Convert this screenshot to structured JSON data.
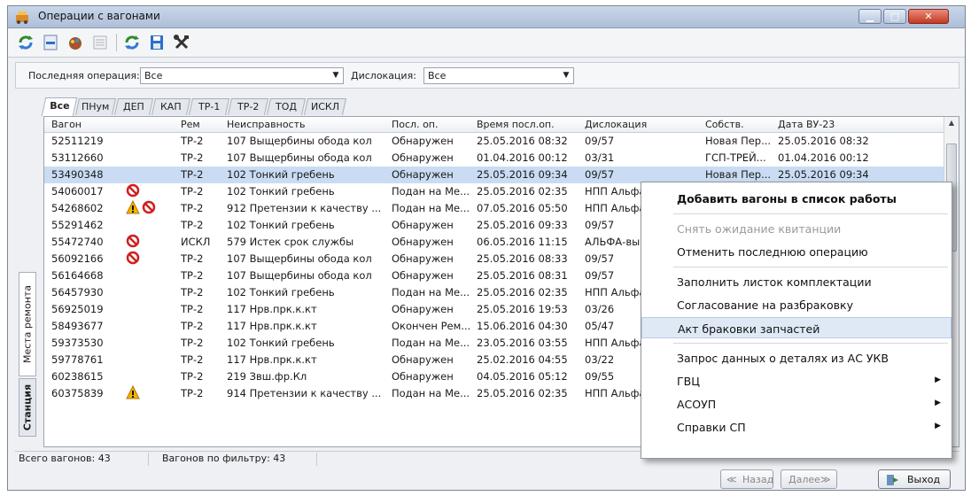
{
  "window": {
    "title": "Операции с вагонами"
  },
  "toolbar": {
    "icons": [
      "refresh-icon",
      "remove-icon",
      "paint-icon",
      "list-icon",
      "reload-icon",
      "save-icon",
      "tools-icon"
    ]
  },
  "filters": {
    "last_operation_label": "Последняя операция:",
    "last_operation_value": "Все",
    "dislocation_label": "Дислокация:",
    "dislocation_value": "Все"
  },
  "tabs": [
    "Все",
    "ПНум",
    "ДЕП",
    "КАП",
    "ТР-1",
    "ТР-2",
    "ТОД",
    "ИСКЛ"
  ],
  "side_tabs": [
    "Места ремонта",
    "Станция"
  ],
  "columns": [
    "Вагон",
    "Рем",
    "Неисправность",
    "Посл. оп.",
    "Время посл.оп.",
    "Дислокация",
    "Собств.",
    "Дата ВУ-23"
  ],
  "rows": [
    {
      "wagon": "52511219",
      "icons": [],
      "rem": "ТР-2",
      "fault": "107 Выщербины обода кол",
      "oper": "Обнаружен",
      "time": "25.05.2016 08:32",
      "disl": "09/57",
      "owner": "Новая Пер...",
      "date": "25.05.2016 08:32"
    },
    {
      "wagon": "53112660",
      "icons": [],
      "rem": "ТР-2",
      "fault": "107 Выщербины обода кол",
      "oper": "Обнаружен",
      "time": "01.04.2016 00:12",
      "disl": "03/31",
      "owner": "ГСП-ТРЕЙ...",
      "date": "01.04.2016 00:12"
    },
    {
      "wagon": "53490348",
      "icons": [],
      "rem": "ТР-2",
      "fault": "102 Тонкий гребень",
      "oper": "Обнаружен",
      "time": "25.05.2016 09:34",
      "disl": "09/57",
      "owner": "Новая Пер...",
      "date": "25.05.2016 09:34"
    },
    {
      "wagon": "54060017",
      "icons": [
        "no-entry-icon"
      ],
      "rem": "ТР-2",
      "fault": "102 Тонкий гребень",
      "oper": "Подан на Ме...",
      "time": "25.05.2016 02:35",
      "disl": "НПП Альфа",
      "owner": "",
      "date": ""
    },
    {
      "wagon": "54268602",
      "icons": [
        "warning-icon",
        "no-entry-icon"
      ],
      "rem": "ТР-2",
      "fault": "912 Претензии к качеству ...",
      "oper": "Подан на Ме...",
      "time": "07.05.2016 05:50",
      "disl": "НПП Альфа",
      "owner": "",
      "date": ""
    },
    {
      "wagon": "55291462",
      "icons": [],
      "rem": "ТР-2",
      "fault": "102 Тонкий гребень",
      "oper": "Обнаружен",
      "time": "25.05.2016 09:33",
      "disl": "09/57",
      "owner": "",
      "date": ""
    },
    {
      "wagon": "55472740",
      "icons": [
        "no-entry-icon"
      ],
      "rem": "ИСКЛ",
      "fault": "579 Истек срок службы",
      "oper": "Обнаружен",
      "time": "06.05.2016 11:15",
      "disl": "АЛЬФА-выгр",
      "owner": "",
      "date": ""
    },
    {
      "wagon": "56092166",
      "icons": [
        "no-entry-icon"
      ],
      "rem": "ТР-2",
      "fault": "107 Выщербины обода кол",
      "oper": "Обнаружен",
      "time": "25.05.2016 08:33",
      "disl": "09/57",
      "owner": "",
      "date": ""
    },
    {
      "wagon": "56164668",
      "icons": [],
      "rem": "ТР-2",
      "fault": "107 Выщербины обода кол",
      "oper": "Обнаружен",
      "time": "25.05.2016 08:31",
      "disl": "09/57",
      "owner": "",
      "date": ""
    },
    {
      "wagon": "56457930",
      "icons": [],
      "rem": "ТР-2",
      "fault": "102 Тонкий гребень",
      "oper": "Подан на Ме...",
      "time": "25.05.2016 02:35",
      "disl": "НПП Альфа",
      "owner": "",
      "date": ""
    },
    {
      "wagon": "56925019",
      "icons": [],
      "rem": "ТР-2",
      "fault": "117 Нрв.прк.к.кт",
      "oper": "Обнаружен",
      "time": "25.05.2016 19:53",
      "disl": "03/26",
      "owner": "",
      "date": ""
    },
    {
      "wagon": "58493677",
      "icons": [],
      "rem": "ТР-2",
      "fault": "117 Нрв.прк.к.кт",
      "oper": "Окончен Рем...",
      "time": "15.06.2016 04:30",
      "disl": "05/47",
      "owner": "",
      "date": ""
    },
    {
      "wagon": "59373530",
      "icons": [],
      "rem": "ТР-2",
      "fault": "102 Тонкий гребень",
      "oper": "Подан на Ме...",
      "time": "23.05.2016 03:55",
      "disl": "НПП Альфа",
      "owner": "",
      "date": ""
    },
    {
      "wagon": "59778761",
      "icons": [],
      "rem": "ТР-2",
      "fault": "117 Нрв.прк.к.кт",
      "oper": "Обнаружен",
      "time": "25.02.2016 04:55",
      "disl": "03/22",
      "owner": "",
      "date": ""
    },
    {
      "wagon": "60238615",
      "icons": [],
      "rem": "ТР-2",
      "fault": "219 Звш.фр.Кл",
      "oper": "Обнаружен",
      "time": "04.05.2016 05:12",
      "disl": "09/55",
      "owner": "",
      "date": ""
    },
    {
      "wagon": "60375839",
      "icons": [
        "warning-icon"
      ],
      "rem": "ТР-2",
      "fault": "914 Претензии к качеству ...",
      "oper": "Подан на Ме...",
      "time": "25.05.2016 02:35",
      "disl": "НПП Альфа",
      "owner": "",
      "date": ""
    }
  ],
  "selected_row": 2,
  "status": {
    "total": "Всего вагонов: 43",
    "filtered": "Вагонов по фильтру: 43"
  },
  "nav": {
    "back": "Назад",
    "next": "Далее",
    "exit": "Выход"
  },
  "context_menu": [
    {
      "label": "Добавить вагоны в список работы",
      "bold": true
    },
    {
      "sep": true
    },
    {
      "label": "Снять ожидание квитанции",
      "disabled": true
    },
    {
      "label": "Отменить последнюю операцию"
    },
    {
      "sep": true
    },
    {
      "label": "Заполнить листок комплектации"
    },
    {
      "label": "Согласование на разбраковку"
    },
    {
      "label": "Акт браковки запчастей",
      "highlight": true
    },
    {
      "sep": true
    },
    {
      "label": "Запрос данных о деталях из АС УКВ"
    },
    {
      "label": "ГВЦ",
      "submenu": true
    },
    {
      "label": "АСОУП",
      "submenu": true
    },
    {
      "label": "Справки СП",
      "submenu": true
    }
  ]
}
